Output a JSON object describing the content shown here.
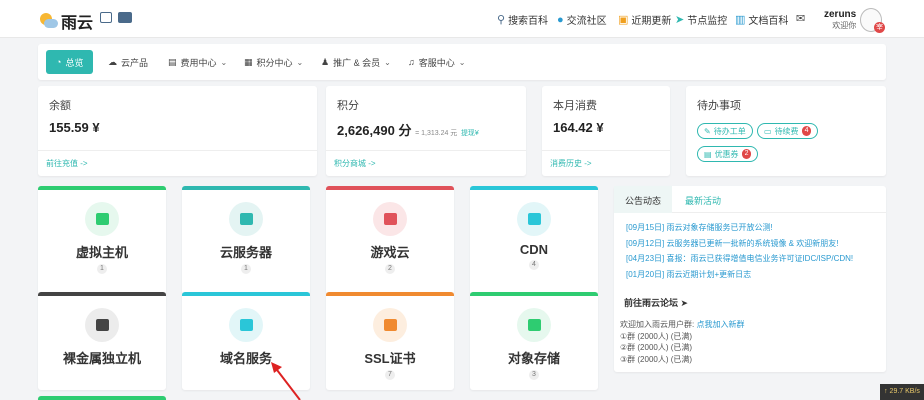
{
  "header": {
    "brand": "雨云",
    "nav": [
      {
        "icon": "search-icon",
        "glyph": "⚲",
        "label": "搜索百科",
        "color": "#4a6a8a"
      },
      {
        "icon": "drop-icon",
        "glyph": "●",
        "label": "交流社区",
        "color": "#2a9ad0"
      },
      {
        "icon": "calendar-icon",
        "glyph": "▣",
        "label": "近期更新",
        "color": "#f0a020"
      },
      {
        "icon": "send-icon",
        "glyph": "➤",
        "label": "节点监控",
        "color": "#2fb8b0"
      },
      {
        "icon": "book-icon",
        "glyph": "▥",
        "label": "文档百科",
        "color": "#2a9ad0"
      },
      {
        "icon": "mail-icon",
        "glyph": "✉",
        "label": "",
        "color": "#444"
      }
    ],
    "user": {
      "name": "zeruns",
      "welcome": "欢迎你",
      "badge": "宰"
    }
  },
  "menu": [
    {
      "label": "总览",
      "icon": "gauge-icon",
      "glyph": "◔",
      "active": true
    },
    {
      "label": "云产品",
      "icon": "cloud-icon",
      "glyph": "☁"
    },
    {
      "label": "费用中心",
      "icon": "wallet-icon",
      "glyph": "▤",
      "dropdown": true
    },
    {
      "label": "积分中心",
      "icon": "gift-icon",
      "glyph": "▦",
      "dropdown": true
    },
    {
      "label": "推广 & 会员",
      "icon": "users-icon",
      "glyph": "♟",
      "dropdown": true
    },
    {
      "label": "客服中心",
      "icon": "headset-icon",
      "glyph": "♫",
      "dropdown": true
    }
  ],
  "stats": {
    "balance": {
      "label": "余额",
      "value": "155.59 ¥",
      "link": "前往充值 ->"
    },
    "points": {
      "label": "积分",
      "value": "2,626,490 分",
      "note": "= 1,313.24 元",
      "note_link": "提现¥",
      "link": "积分商城 ->"
    },
    "spend": {
      "label": "本月消费",
      "value": "164.42 ¥",
      "link": "消费历史 ->"
    },
    "todo": {
      "label": "待办事项",
      "items": [
        {
          "label": "待办工单",
          "icon": "pen-icon",
          "glyph": "✎"
        },
        {
          "label": "待续费",
          "icon": "server-icon",
          "glyph": "▭",
          "count": "4"
        },
        {
          "label": "优惠券",
          "icon": "ticket-icon",
          "glyph": "▤",
          "count": "2"
        }
      ]
    }
  },
  "products": [
    {
      "label": "虚拟主机",
      "count": "1",
      "icon": "database-icon",
      "top": "#2ecc71",
      "circle": "#e6f8ee",
      "glyph": "#2ecc71"
    },
    {
      "label": "云服务器",
      "count": "1",
      "icon": "cube-icon",
      "top": "#2fb8b0",
      "circle": "#e4f4f3",
      "glyph": "#2fb8b0"
    },
    {
      "label": "游戏云",
      "count": "2",
      "icon": "gamepad-icon",
      "top": "#e0525a",
      "circle": "#fbe6e7",
      "glyph": "#e0525a"
    },
    {
      "label": "CDN",
      "count": "4",
      "icon": "network-icon",
      "top": "#2ac6d8",
      "circle": "#e2f6f8",
      "glyph": "#2ac6d8"
    },
    {
      "label": "裸金属独立机",
      "count": "",
      "icon": "chip-icon",
      "top": "#444444",
      "circle": "#ececec",
      "glyph": "#444444"
    },
    {
      "label": "域名服务",
      "count": "",
      "icon": "globe-icon",
      "top": "#2ac6d8",
      "circle": "#e2f6f8",
      "glyph": "#2ac6d8"
    },
    {
      "label": "SSL证书",
      "count": "7",
      "icon": "key-icon",
      "top": "#f08a30",
      "circle": "#fdeedf",
      "glyph": "#f08a30"
    },
    {
      "label": "对象存储",
      "count": "3",
      "icon": "storage-icon",
      "top": "#2ecc71",
      "circle": "#e6f8ee",
      "glyph": "#2ecc71"
    }
  ],
  "news": {
    "tabs": [
      "公告动态",
      "最新活动"
    ],
    "items": [
      "[09月15日] 雨云对象存储服务已开放公测!",
      "[09月12日] 云服务器已更新一批新的系统镜像 & 欢迎新朋友!",
      "[04月23日] 喜报：雨云已获得增值电信业务许可证IDC/ISP/CDN!",
      "[01月20日] 雨云近期计划+更新日志"
    ],
    "forum_title": "前往雨云论坛",
    "forum_lines": [
      {
        "text": "欢迎加入雨云用户群: ",
        "link": "点我加入新群"
      },
      {
        "text": "①群 (2000人) (已满)"
      },
      {
        "text": "②群 (2000人) (已满)"
      },
      {
        "text": "③群 (2000人) (已满)"
      }
    ]
  },
  "speed": "29.7 KB/s"
}
